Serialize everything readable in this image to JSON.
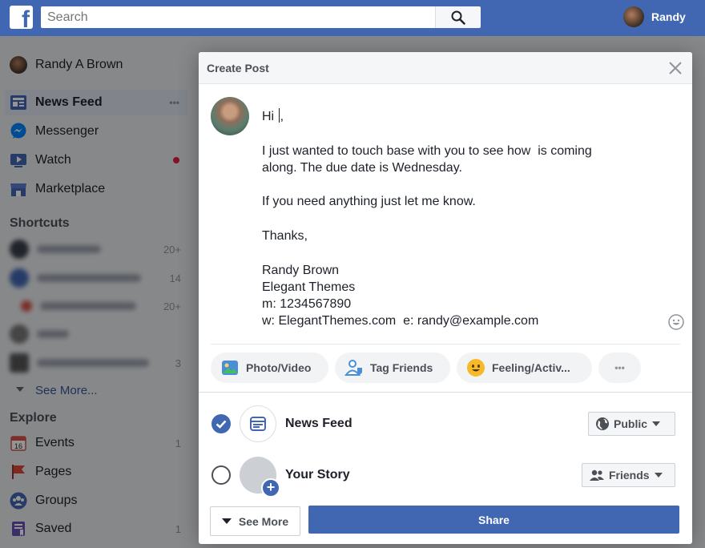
{
  "topbar": {
    "logo_letter": "f",
    "search_placeholder": "Search",
    "user_name": "Randy"
  },
  "sidebar": {
    "profile_name": "Randy A Brown",
    "items": [
      {
        "label": "News Feed",
        "icon": "news-feed-icon"
      },
      {
        "label": "Messenger",
        "icon": "messenger-icon"
      },
      {
        "label": "Watch",
        "icon": "watch-icon"
      },
      {
        "label": "Marketplace",
        "icon": "marketplace-icon"
      }
    ],
    "more_glyph": "•••",
    "shortcuts_heading": "Shortcuts",
    "shortcut_counts": [
      "20+",
      "14",
      "20+",
      "",
      "3"
    ],
    "see_more": "See More...",
    "explore_heading": "Explore",
    "explore_items": [
      {
        "label": "Events",
        "count": "1",
        "icon": "calendar-icon"
      },
      {
        "label": "Pages",
        "count": "",
        "icon": "flag-icon"
      },
      {
        "label": "Groups",
        "count": "",
        "icon": "groups-icon"
      },
      {
        "label": "Saved",
        "count": "1",
        "icon": "saved-icon"
      }
    ]
  },
  "modal": {
    "title": "Create Post",
    "body": {
      "greeting_before_caret": "Hi ",
      "greeting_after_caret": ",",
      "line1": "I just wanted to touch base with you to see how  is coming",
      "line2": "along. The due date is Wednesday.",
      "line3": "If you need anything just let me know.",
      "line4": "Thanks,",
      "sig_name": "Randy Brown",
      "sig_company": "Elegant Themes",
      "sig_phone": "m: 1234567890",
      "sig_web": "w: ElegantThemes.com  e: randy@example.com"
    },
    "actions": [
      {
        "label": "Photo/Video",
        "icon": "photo-video-icon"
      },
      {
        "label": "Tag Friends",
        "icon": "tag-friends-icon"
      },
      {
        "label": "Feeling/Activ...",
        "icon": "feeling-icon"
      }
    ],
    "more_actions_glyph": "•••",
    "destinations": [
      {
        "label": "News Feed",
        "audience": "Public",
        "checked": true
      },
      {
        "label": "Your Story",
        "audience": "Friends",
        "checked": false
      }
    ],
    "see_more_label": "See More",
    "share_label": "Share"
  },
  "colors": {
    "brand": "#4267b2",
    "overlay": "rgba(0,0,0,0.42)",
    "watch_dot": "#e41e3f"
  }
}
